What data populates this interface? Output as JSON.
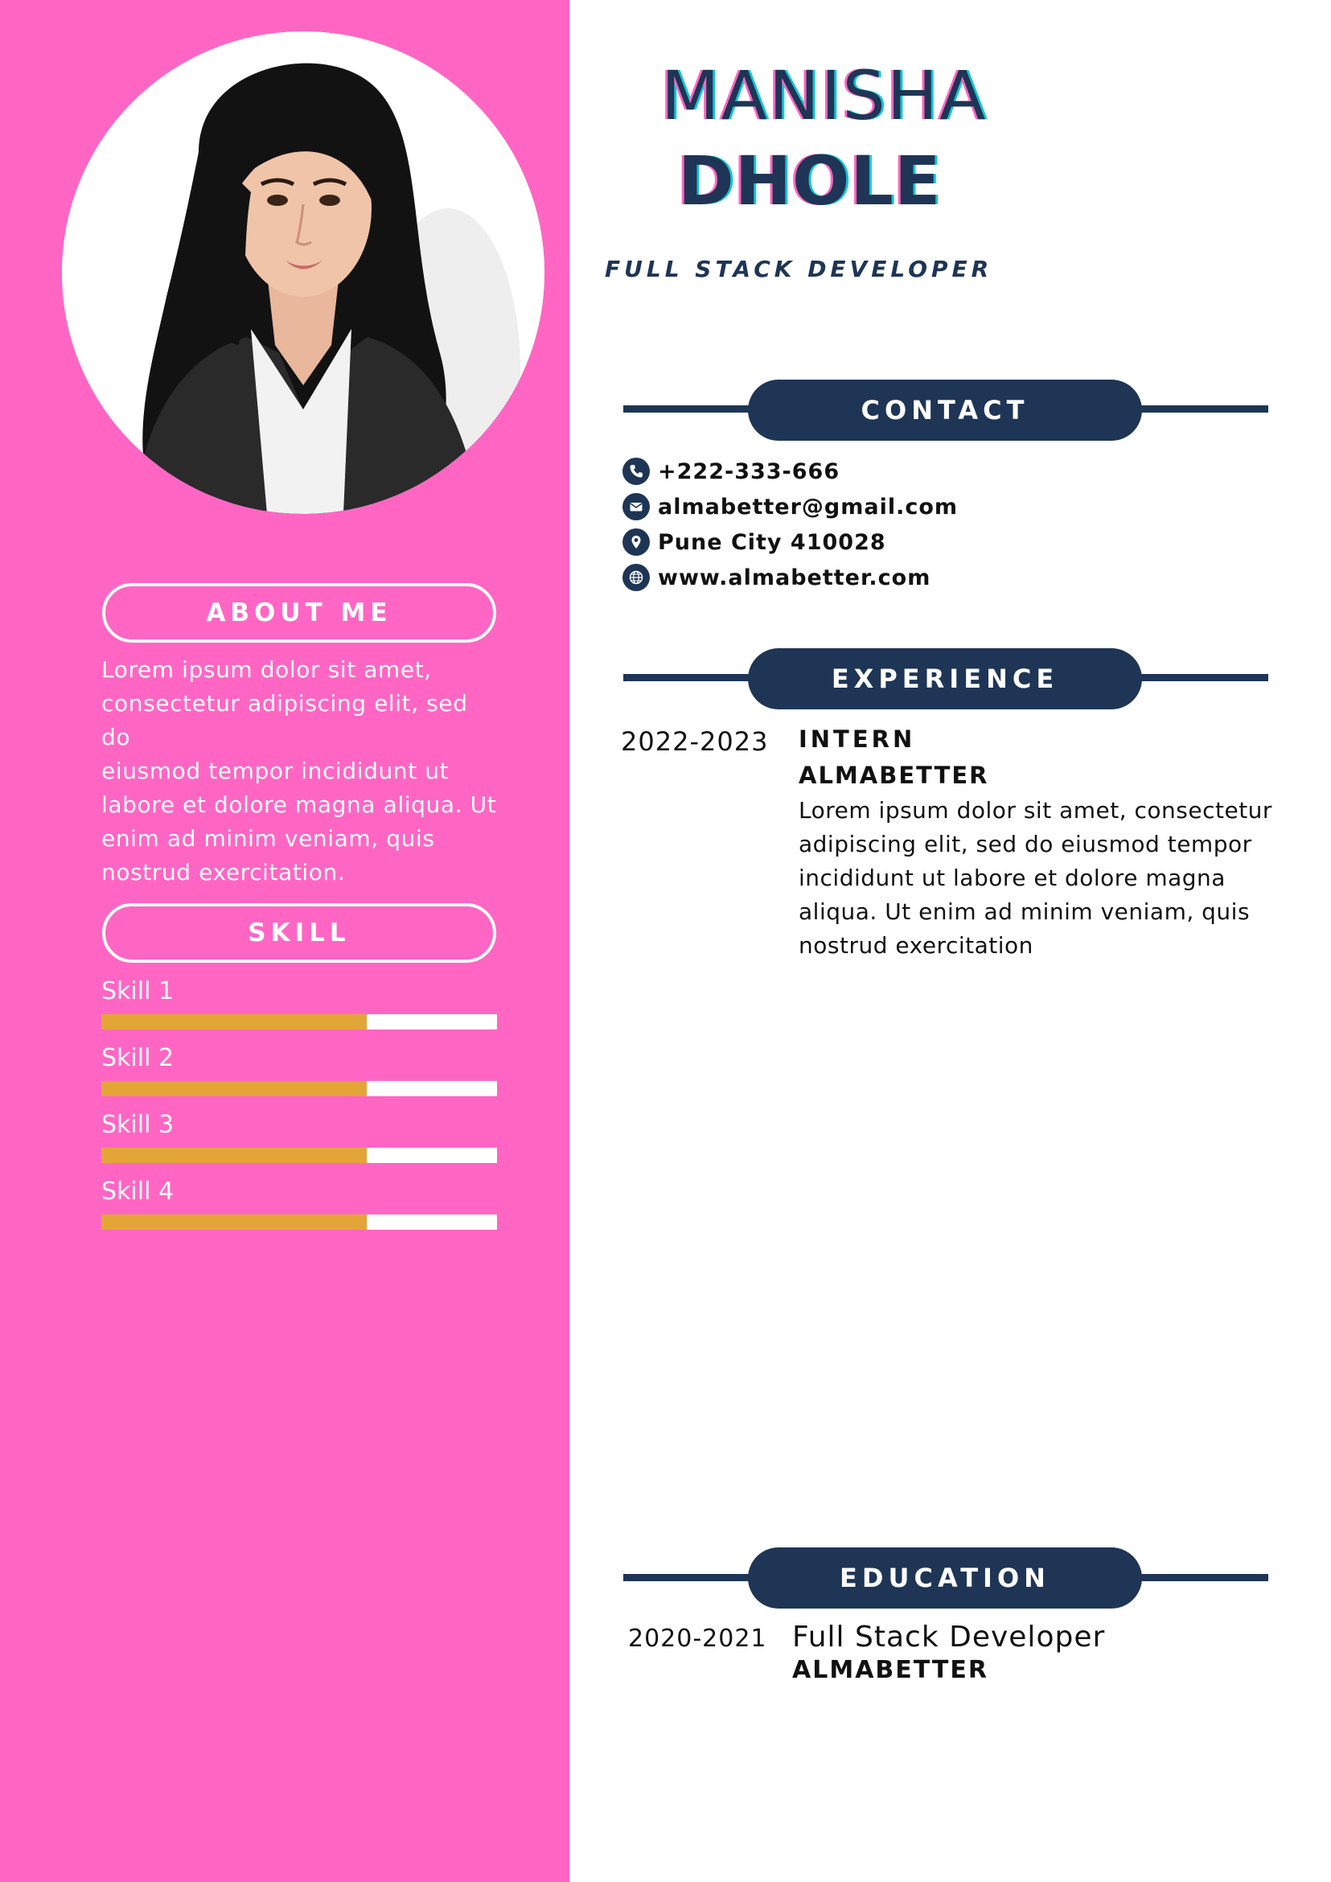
{
  "colors": {
    "sidebar": "#ff66c4",
    "navy": "#1e3555",
    "skill_bar": "#e3a536",
    "white": "#ffffff"
  },
  "profile": {
    "first_name": "MANISHA",
    "last_name": "DHOLE",
    "title": "FULL STACK DEVELOPER"
  },
  "sidebar": {
    "about": {
      "heading": "ABOUT ME",
      "lines": [
        "Lorem ipsum dolor sit amet,",
        "consectetur adipiscing elit, sed do",
        "eiusmod tempor incididunt ut",
        "labore et dolore magna aliqua. Ut",
        "enim ad minim veniam, quis",
        "nostrud exercitation."
      ]
    },
    "skills": {
      "heading": "SKILL",
      "items": [
        {
          "label": "Skill 1",
          "level": 0.67
        },
        {
          "label": "Skill 2",
          "level": 0.67
        },
        {
          "label": "Skill 3",
          "level": 0.67
        },
        {
          "label": "Skill 4",
          "level": 0.67
        }
      ]
    }
  },
  "contact": {
    "heading": "CONTACT",
    "phone": "+222-333-666",
    "email": "almabetter@gmail.com",
    "address": "Pune City 410028",
    "website": "www.almabetter.com",
    "icons": [
      "phone-icon",
      "email-icon",
      "location-icon",
      "globe-icon"
    ]
  },
  "experience": {
    "heading": "EXPERIENCE",
    "items": [
      {
        "years": "2022-2023",
        "role": "INTERN",
        "company": "ALMABETTER",
        "lines": [
          "Lorem ipsum dolor sit amet, consectetur",
          "adipiscing elit, sed do eiusmod tempor",
          "incididunt ut labore et dolore magna",
          "aliqua. Ut enim ad minim veniam, quis",
          "nostrud exercitation"
        ]
      }
    ]
  },
  "education": {
    "heading": "EDUCATION",
    "items": [
      {
        "years": "2020-2021",
        "degree": "Full Stack Developer",
        "school": "ALMABETTER"
      }
    ]
  }
}
